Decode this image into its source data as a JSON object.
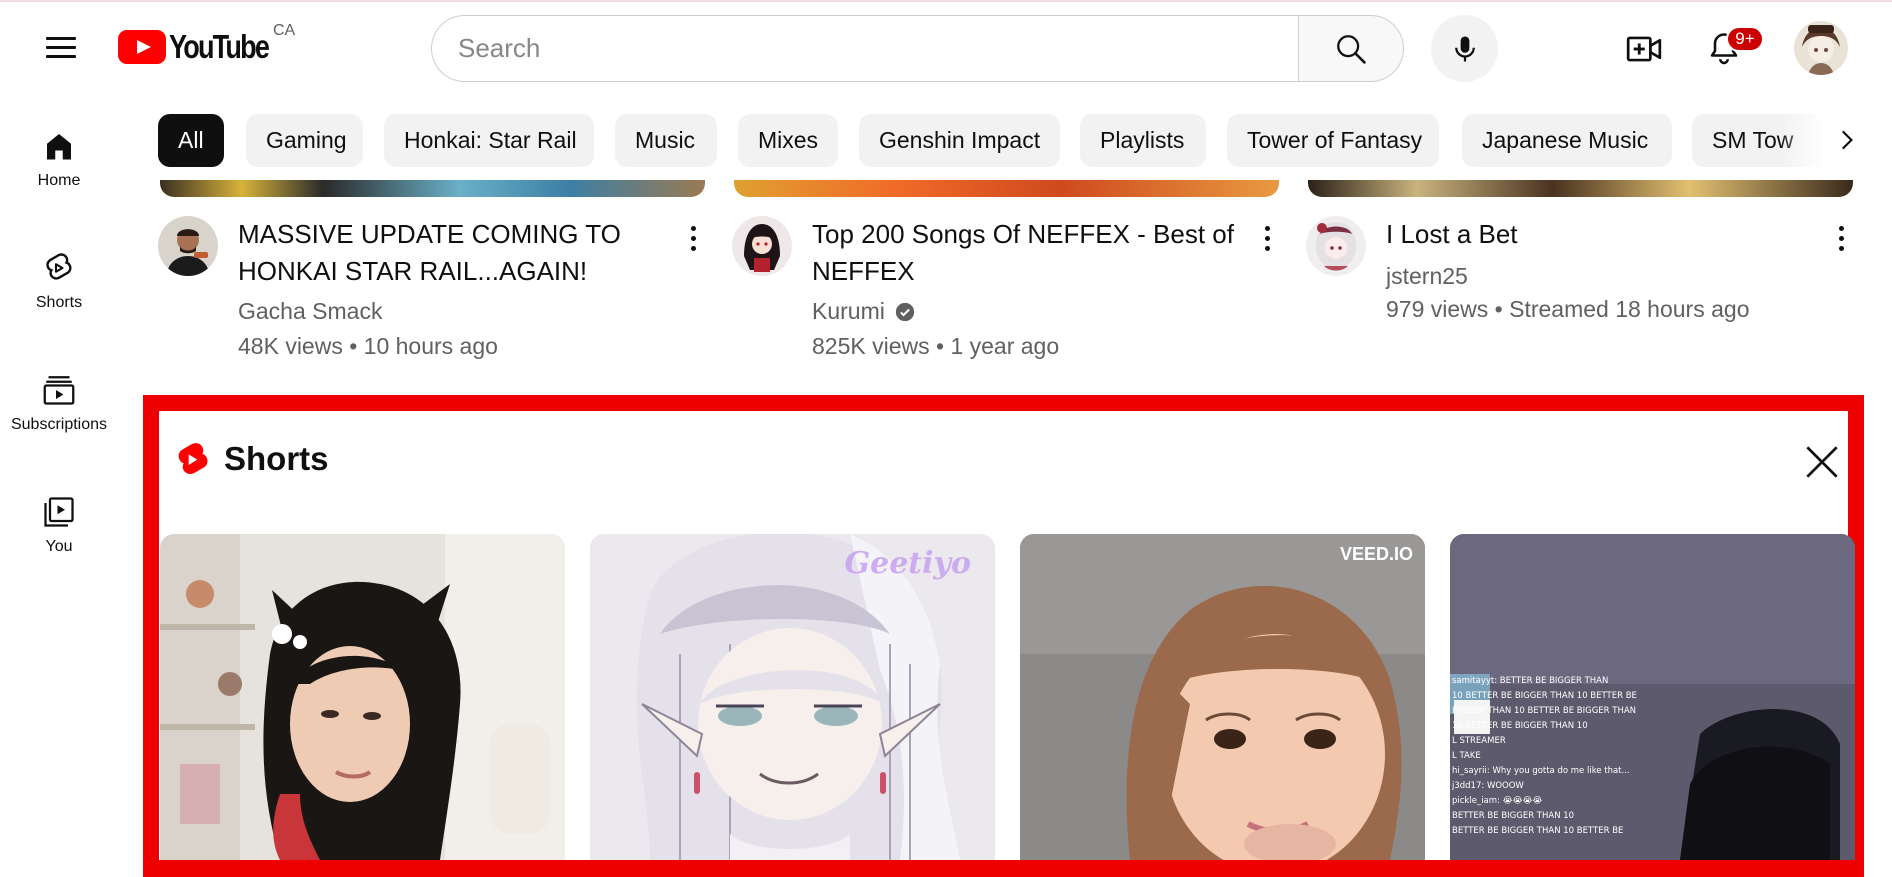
{
  "header": {
    "logo_text": "YouTube",
    "country_code": "CA",
    "search_placeholder": "Search",
    "notification_count": "9+",
    "icons": [
      "menu-icon",
      "search-icon",
      "mic-icon",
      "create-video-icon",
      "bell-icon",
      "avatar"
    ]
  },
  "sidebar": {
    "items": [
      {
        "label": "Home",
        "icon": "home-icon"
      },
      {
        "label": "Shorts",
        "icon": "shorts-icon"
      },
      {
        "label": "Subscriptions",
        "icon": "subscriptions-icon"
      },
      {
        "label": "You",
        "icon": "you-icon"
      }
    ]
  },
  "chips": [
    "All",
    "Gaming",
    "Honkai: Star Rail",
    "Music",
    "Mixes",
    "Genshin Impact",
    "Playlists",
    "Tower of Fantasy",
    "Japanese Music",
    "SM Tow"
  ],
  "videos": [
    {
      "title_line1": "MASSIVE UPDATE COMING TO",
      "title_line2": "HONKAI STAR RAIL...AGAIN!",
      "channel": "Gacha Smack",
      "meta": "48K views • 10 hours ago",
      "verified": false
    },
    {
      "title_line1": "Top 200 Songs Of NEFFEX - Best of",
      "title_line2": "NEFFEX",
      "channel": "Kurumi",
      "meta": "825K views • 1 year ago",
      "verified": true
    },
    {
      "title_line1": "I Lost a Bet",
      "title_line2": "",
      "channel": "jstern25",
      "meta": "979 views • Streamed 18 hours ago",
      "verified": false
    }
  ],
  "shorts_shelf": {
    "title": "Shorts",
    "highlight_color": "#ee0000",
    "cards": [
      {
        "overlay": ""
      },
      {
        "overlay": "Geetiyo"
      },
      {
        "overlay": "VEED.IO"
      },
      {
        "overlay": ""
      }
    ],
    "chat_lines": [
      "samitayyt: BETTER BE BIGGER THAN",
      "10 BETTER BE BIGGER THAN 10 BETTER BE",
      "BIGGER THAN 10 BETTER BE BIGGER THAN",
      "10 BETTER BE BIGGER THAN 10",
      "",
      "L STREAMER",
      "",
      "L TAKE",
      "",
      "hi_sayrii: Why you gotta do me like that...",
      "j3dd17: WOOOW",
      "",
      "pickle_iam: 😭😭😭😭",
      "",
      "BETTER BE BIGGER THAN 10",
      "BETTER BE BIGGER THAN 10 BETTER BE"
    ]
  },
  "colors": {
    "brand_red": "#ff0000",
    "chip_bg": "#f2f2f2",
    "chip_active_bg": "#0f0f0f",
    "secondary_text": "#606060"
  }
}
